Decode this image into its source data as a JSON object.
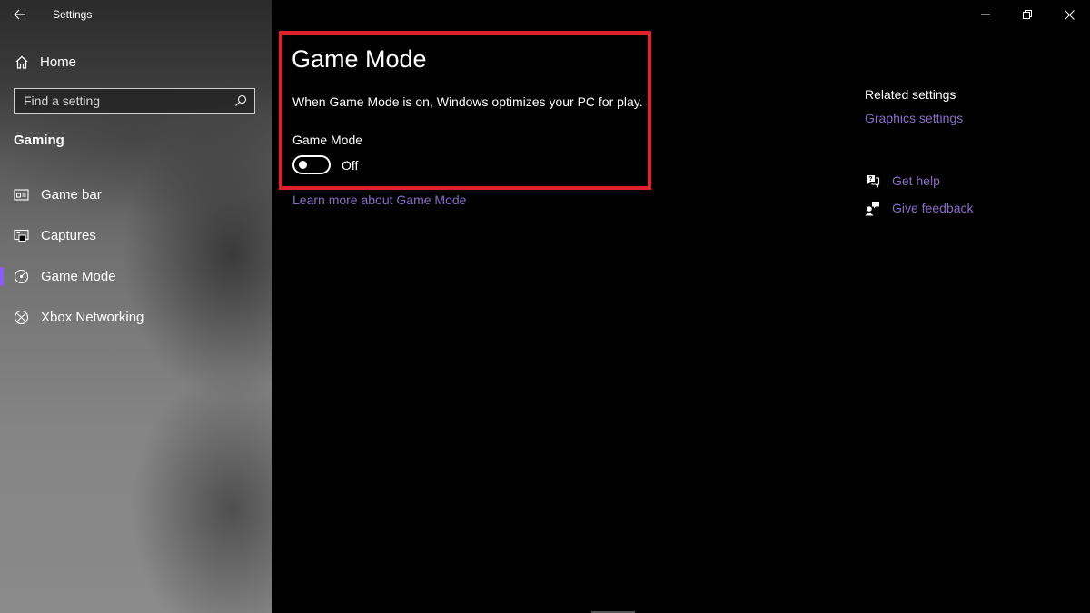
{
  "window": {
    "app_title": "Settings",
    "controls": [
      "minimize",
      "restore",
      "close"
    ]
  },
  "sidebar": {
    "home_label": "Home",
    "search": {
      "placeholder": "Find a setting",
      "value": ""
    },
    "section_title": "Gaming",
    "items": [
      {
        "label": "Game bar",
        "icon": "game-bar-icon",
        "active": false
      },
      {
        "label": "Captures",
        "icon": "captures-icon",
        "active": false
      },
      {
        "label": "Game Mode",
        "icon": "game-mode-icon",
        "active": true
      },
      {
        "label": "Xbox Networking",
        "icon": "xbox-icon",
        "active": false
      }
    ]
  },
  "main": {
    "title": "Game Mode",
    "description": "When Game Mode is on, Windows optimizes your PC for play.",
    "toggle": {
      "label": "Game Mode",
      "state": "Off",
      "on": false
    },
    "learn_more": "Learn more about Game Mode"
  },
  "related": {
    "heading": "Related settings",
    "link": "Graphics settings"
  },
  "help": {
    "get_help": "Get help",
    "give_feedback": "Give feedback"
  },
  "colors": {
    "accent": "#8b5cf6",
    "link": "#8a6cc8",
    "highlight": "#e0202a",
    "background": "#000000"
  }
}
